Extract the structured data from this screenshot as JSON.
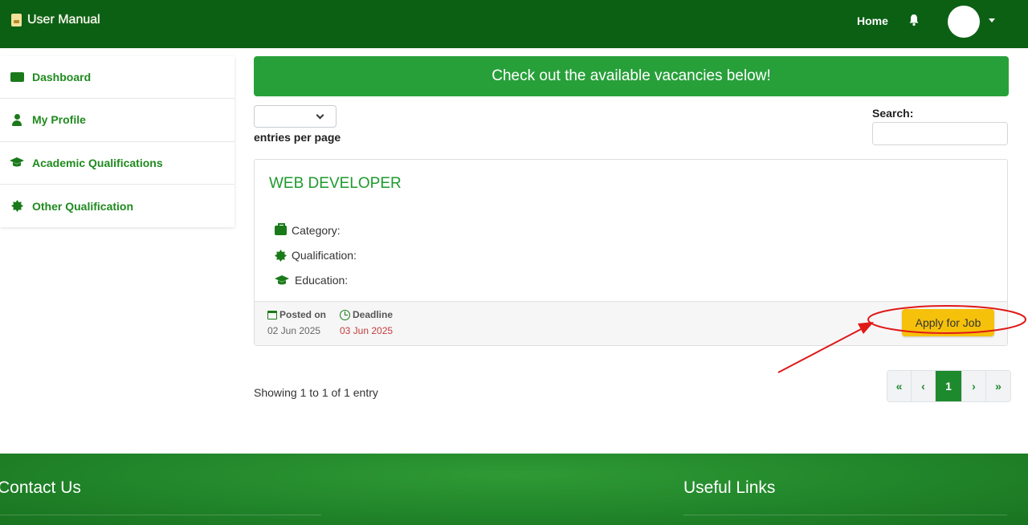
{
  "header": {
    "brand_label": "User Manual",
    "home_label": "Home"
  },
  "sidebar": {
    "items": [
      {
        "label": "Dashboard",
        "icon": "folder-open-icon"
      },
      {
        "label": "My Profile",
        "icon": "user-icon"
      },
      {
        "label": "Academic Qualifications",
        "icon": "graduation-cap-icon"
      },
      {
        "label": "Other Qualification",
        "icon": "certificate-icon"
      }
    ]
  },
  "main": {
    "banner": "Check out the available vacancies below!",
    "entries_select_value": "",
    "entries_label": "entries per page",
    "search_label": "Search:",
    "search_value": "",
    "job": {
      "title": "WEB DEVELOPER",
      "category_label": "Category:",
      "qualification_label": "Qualification:",
      "education_label": "Education:",
      "posted_label": "Posted on",
      "posted_date": "02 Jun 2025",
      "deadline_label": "Deadline",
      "deadline_date": "03 Jun 2025",
      "apply_label": "Apply for Job"
    },
    "showing_text": "Showing 1 to 1 of 1 entry",
    "pagination": {
      "first": "«",
      "prev": "‹",
      "current": "1",
      "next": "›",
      "last": "»"
    }
  },
  "footer": {
    "contact_title": "Contact Us",
    "links_title": "Useful Links"
  },
  "colors": {
    "header_bg": "#0b6014",
    "accent_green": "#28a03a",
    "apply_yellow": "#f6c10a",
    "deadline_red": "#c43c3c",
    "annotation_red": "#e01818"
  }
}
